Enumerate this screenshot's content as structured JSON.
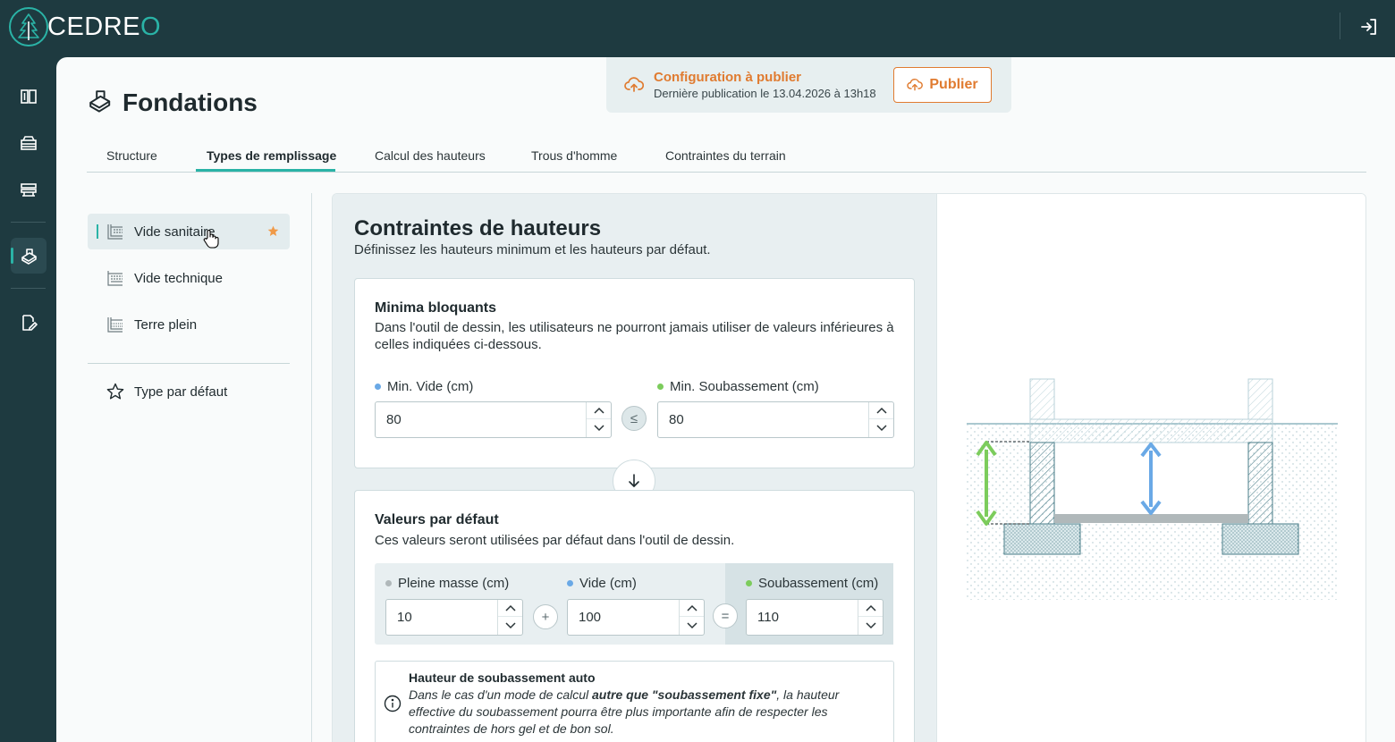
{
  "app": {
    "logo_text_a": "CEDRE",
    "logo_text_b": "O",
    "accent": "#2ab3a6",
    "bg_dark": "#1e3a40",
    "orange": "#e07b30"
  },
  "rail": {
    "items": [
      {
        "icon": "catalog-icon"
      },
      {
        "icon": "box-icon"
      },
      {
        "icon": "layers-icon"
      },
      {
        "icon": "foundation-icon",
        "active": true
      },
      {
        "icon": "edit-doc-icon"
      }
    ]
  },
  "page": {
    "title": "Fondations"
  },
  "publish": {
    "title": "Configuration à publier",
    "subtitle": "Dernière publication le 13.04.2026 à 13h18",
    "button_label": "Publier"
  },
  "tabs": [
    {
      "label": "Structure"
    },
    {
      "label": "Types de remplissage",
      "active": true
    },
    {
      "label": "Calcul des hauteurs"
    },
    {
      "label": "Trous d'homme"
    },
    {
      "label": "Contraintes du terrain"
    }
  ],
  "types": {
    "items": [
      {
        "label": "Vide sanitaire",
        "selected": true,
        "favorite": true
      },
      {
        "label": "Vide technique"
      },
      {
        "label": "Terre plein"
      }
    ],
    "default_label": "Type par défaut"
  },
  "section": {
    "title": "Contraintes de hauteurs",
    "subtitle": "Définissez les hauteurs minimum et les hauteurs par défaut."
  },
  "minima": {
    "title": "Minima bloquants",
    "text": "Dans l'outil de dessin, les utilisateurs ne pourront jamais utiliser de valeurs inférieures à celles indiquées ci-dessous.",
    "min_vide_label": "Min. Vide (cm)",
    "min_vide_value": "80",
    "operator": "≤",
    "min_soub_label": "Min. Soubassement (cm)",
    "min_soub_value": "80"
  },
  "defaults": {
    "title": "Valeurs par défaut",
    "text": "Ces valeurs seront utilisées par défaut dans l'outil de dessin.",
    "pleine_label": "Pleine masse (cm)",
    "pleine_value": "10",
    "plus": "+",
    "vide_label": "Vide (cm)",
    "vide_value": "100",
    "equals": "=",
    "soub_label": "Soubassement (cm)",
    "soub_value": "110"
  },
  "info": {
    "title": "Hauteur de soubassement auto",
    "text_a": "Dans le cas d'un mode de calcul ",
    "text_b": "autre que \"soubassement fixe\"",
    "text_c": ", la hauteur effective du soubassement pourra être plus importante afin de respecter les contraintes de hors gel et de bon sol."
  },
  "legend_colors": {
    "pleine": "#b0b8ba",
    "vide": "#6aa9e6",
    "soubassement": "#7ccc5c"
  }
}
